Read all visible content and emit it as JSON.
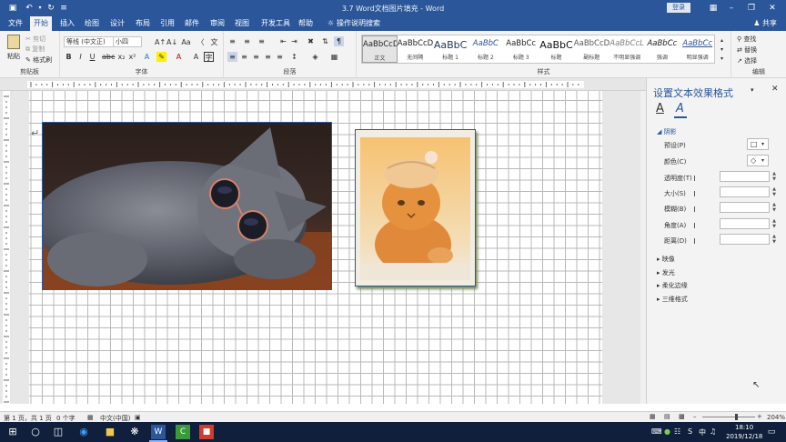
{
  "titlebar": {
    "title": "3.7 Word文档图片填充 - Word",
    "login": "登录"
  },
  "tabs": [
    {
      "label": "文件"
    },
    {
      "label": "开始"
    },
    {
      "label": "插入"
    },
    {
      "label": "绘图"
    },
    {
      "label": "设计"
    },
    {
      "label": "布局"
    },
    {
      "label": "引用"
    },
    {
      "label": "邮件"
    },
    {
      "label": "审阅"
    },
    {
      "label": "视图"
    },
    {
      "label": "开发工具"
    },
    {
      "label": "帮助"
    }
  ],
  "tell_me": "操作说明搜索",
  "share": "共享",
  "ribbon": {
    "clipboard": {
      "paste": "粘贴",
      "cut": "剪切",
      "copy": "复制",
      "format_painter": "格式刷",
      "label": "剪贴板"
    },
    "font": {
      "font_name": "等线 (中文正)",
      "font_size": "小四",
      "label": "字体"
    },
    "paragraph": {
      "label": "段落"
    },
    "styles": {
      "label": "样式",
      "items": [
        {
          "preview": "AaBbCcD",
          "name": "正文"
        },
        {
          "preview": "AaBbCcD",
          "name": "无间隔"
        },
        {
          "preview": "AaBbC",
          "name": "标题 1"
        },
        {
          "preview": "AaBbC",
          "name": "标题 2"
        },
        {
          "preview": "AaBbCc",
          "name": "标题 3"
        },
        {
          "preview": "AaBbC",
          "name": "标题"
        },
        {
          "preview": "AaBbCcD",
          "name": "副标题"
        },
        {
          "preview": "AaBbCcL",
          "name": "不明显强调"
        },
        {
          "preview": "AaBbCc",
          "name": "强调"
        },
        {
          "preview": "AaBbCc",
          "name": "明显强调"
        }
      ]
    },
    "editing": {
      "find": "查找",
      "replace": "替换",
      "select": "选择",
      "label": "编辑"
    }
  },
  "pane": {
    "title": "设置文本效果格式",
    "sections": {
      "shadow": "阴影",
      "reflection": "映像",
      "glow": "发光",
      "soft_edges": "柔化边缘",
      "three_d": "三维格式"
    },
    "fields": {
      "preset": "预设(P)",
      "color": "颜色(C)",
      "transparency": "透明度(T)",
      "size": "大小(S)",
      "blur": "模糊(B)",
      "angle": "角度(A)",
      "distance": "距离(D)"
    }
  },
  "status": {
    "page": "第 1 页，共 1 页",
    "words": "0 个字",
    "language": "中文(中国)",
    "zoom": "204%"
  },
  "taskbar": {
    "time": "18:10",
    "date": "2019/12/18"
  },
  "colors": {
    "accent": "#2b579a",
    "taskbar": "#0f1f3c",
    "ribbon": "#f3f3f3"
  }
}
